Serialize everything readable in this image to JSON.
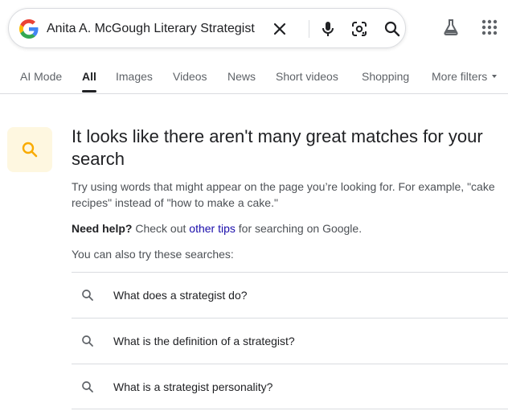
{
  "search": {
    "query": "Anita A. McGough Literary Strategist",
    "logo_icon": "google-g-icon",
    "icons": [
      "close-icon",
      "microphone-icon",
      "google-lens-icon",
      "search-icon"
    ]
  },
  "header_icons": [
    "search-labs-flask-icon",
    "apps-grid-icon"
  ],
  "tabs": [
    {
      "label": "AI Mode",
      "active": false
    },
    {
      "label": "All",
      "active": true
    },
    {
      "label": "Images",
      "active": false
    },
    {
      "label": "Videos",
      "active": false
    },
    {
      "label": "News",
      "active": false
    },
    {
      "label": "Short videos",
      "active": false
    },
    {
      "label": "Shopping",
      "active": false
    },
    {
      "label": "More filters",
      "active": false
    }
  ],
  "notice": {
    "icon": "search-icon",
    "headline": "It looks like there aren't many great matches for your search",
    "hint": "Try using words that might appear on the page you’re looking for. For example, \"cake recipes\" instead of \"how to make a cake.\"",
    "help_bold": "Need help?",
    "help_before_link": " Check out ",
    "help_link": "other tips",
    "help_after_link": " for searching on Google.",
    "also_try": "You can also try these searches:"
  },
  "suggestions": [
    {
      "text": "What does a strategist do?"
    },
    {
      "text": "What is the definition of a strategist?"
    },
    {
      "text": "What is a strategist personality?"
    }
  ],
  "colors": {
    "link": "#1a0dab",
    "notice_bg": "#fef7e0",
    "notice_icon": "#f9ab00",
    "text": "#202124",
    "muted": "#5f6368"
  }
}
